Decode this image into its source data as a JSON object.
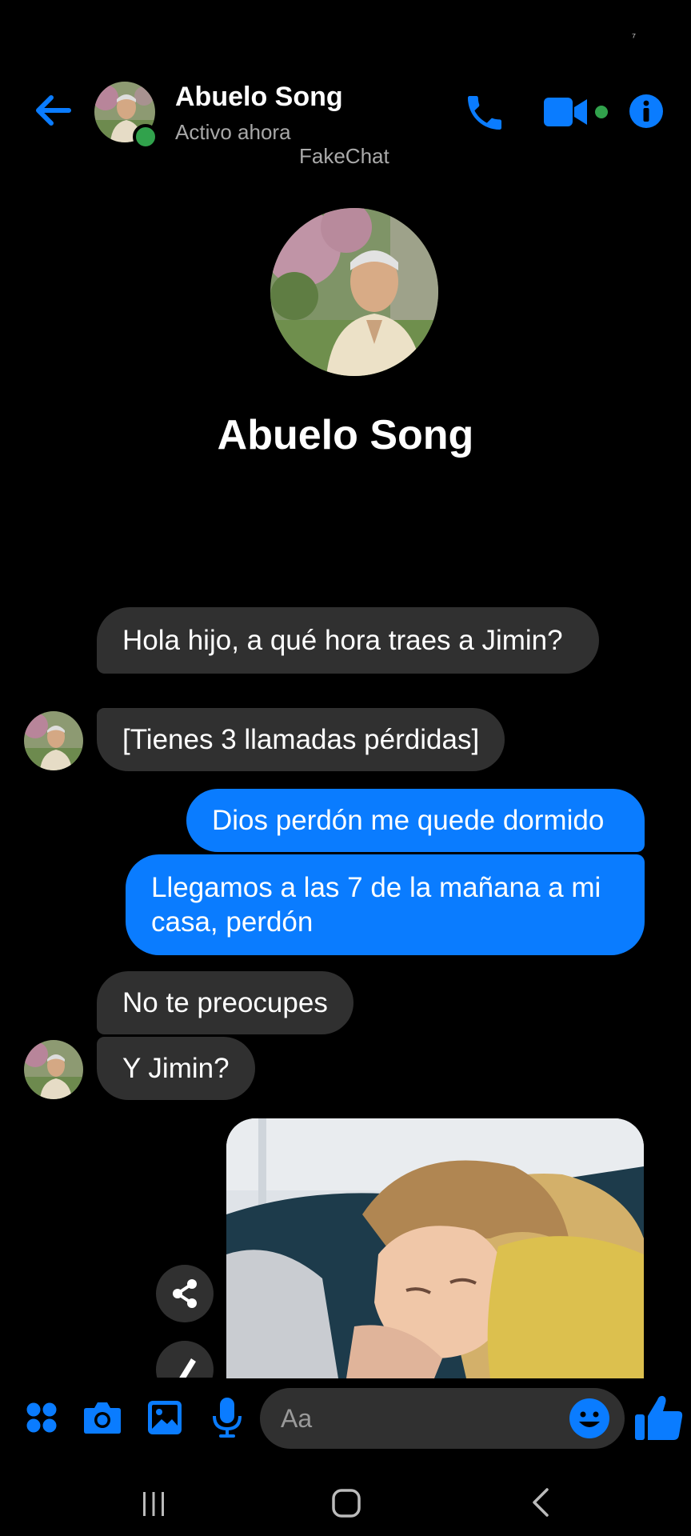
{
  "status_bar": {
    "mark": "⁷"
  },
  "header": {
    "name": "Abuelo Song",
    "status": "Activo ahora",
    "watermark": "FakeChat"
  },
  "profile": {
    "name": "Abuelo Song"
  },
  "messages": [
    {
      "side": "in",
      "text": "Hola hijo, a qué hora traes a Jimin?"
    },
    {
      "side": "in",
      "text": "[Tienes 3 llamadas pérdidas]"
    },
    {
      "side": "out",
      "text": "Dios perdón me quede dormido"
    },
    {
      "side": "out",
      "text": "Llegamos a las 7 de la mañana a mi casa, perdón"
    },
    {
      "side": "in",
      "text": "No te preocupes"
    },
    {
      "side": "in",
      "text": "Y Jimin?"
    },
    {
      "side": "out",
      "type": "photo"
    }
  ],
  "composer": {
    "placeholder": "Aa"
  },
  "colors": {
    "accent": "#0a7cff",
    "incoming": "#303030",
    "online": "#31a24c",
    "background": "#000000"
  },
  "icons": [
    "back-arrow-icon",
    "phone-icon",
    "video-camera-icon",
    "info-icon",
    "share-icon",
    "edit-icon",
    "apps-icon",
    "camera-icon",
    "gallery-icon",
    "microphone-icon",
    "emoji-icon",
    "thumbs-up-icon",
    "recents-icon",
    "home-icon",
    "back-nav-icon"
  ]
}
